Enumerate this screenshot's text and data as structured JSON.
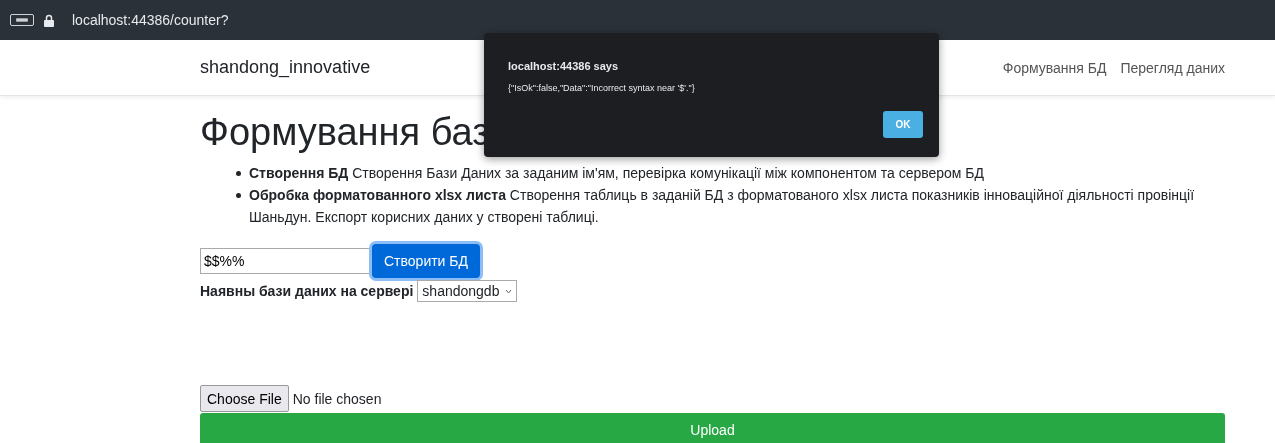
{
  "browser": {
    "address": "localhost:44386/counter?"
  },
  "navbar": {
    "brand": "shandong_innovative",
    "links": [
      "Формування БД",
      "Перегляд даних"
    ]
  },
  "heading": "Формування баз",
  "features": [
    {
      "text": "**Створення БД** Створення Бази Даних за заданим ім'ям, перевірка комунікації між компонентом та сервером БД"
    },
    {
      "text": "**Обробка форматованного xlsx листа** Створення таблиць в заданій БД з форматованого xlsx листа показників інноваційної діяльності провінції Шаньдун. Експорт корисних даних у створені таблиці."
    }
  ],
  "create_form": {
    "name_value": "$$%%",
    "button": "Створити БД"
  },
  "databases": {
    "label": "Наявны бази даних на сервері",
    "selected": "shandongdb"
  },
  "upload": {
    "file_button": "Choose File",
    "file_status": "No file chosen",
    "button": "Upload"
  },
  "alert": {
    "title": "localhost:44386 says",
    "message": "{\"IsOk\":false,\"Data\":\"Incorrect syntax near '$'.\"}",
    "button": "OK"
  }
}
